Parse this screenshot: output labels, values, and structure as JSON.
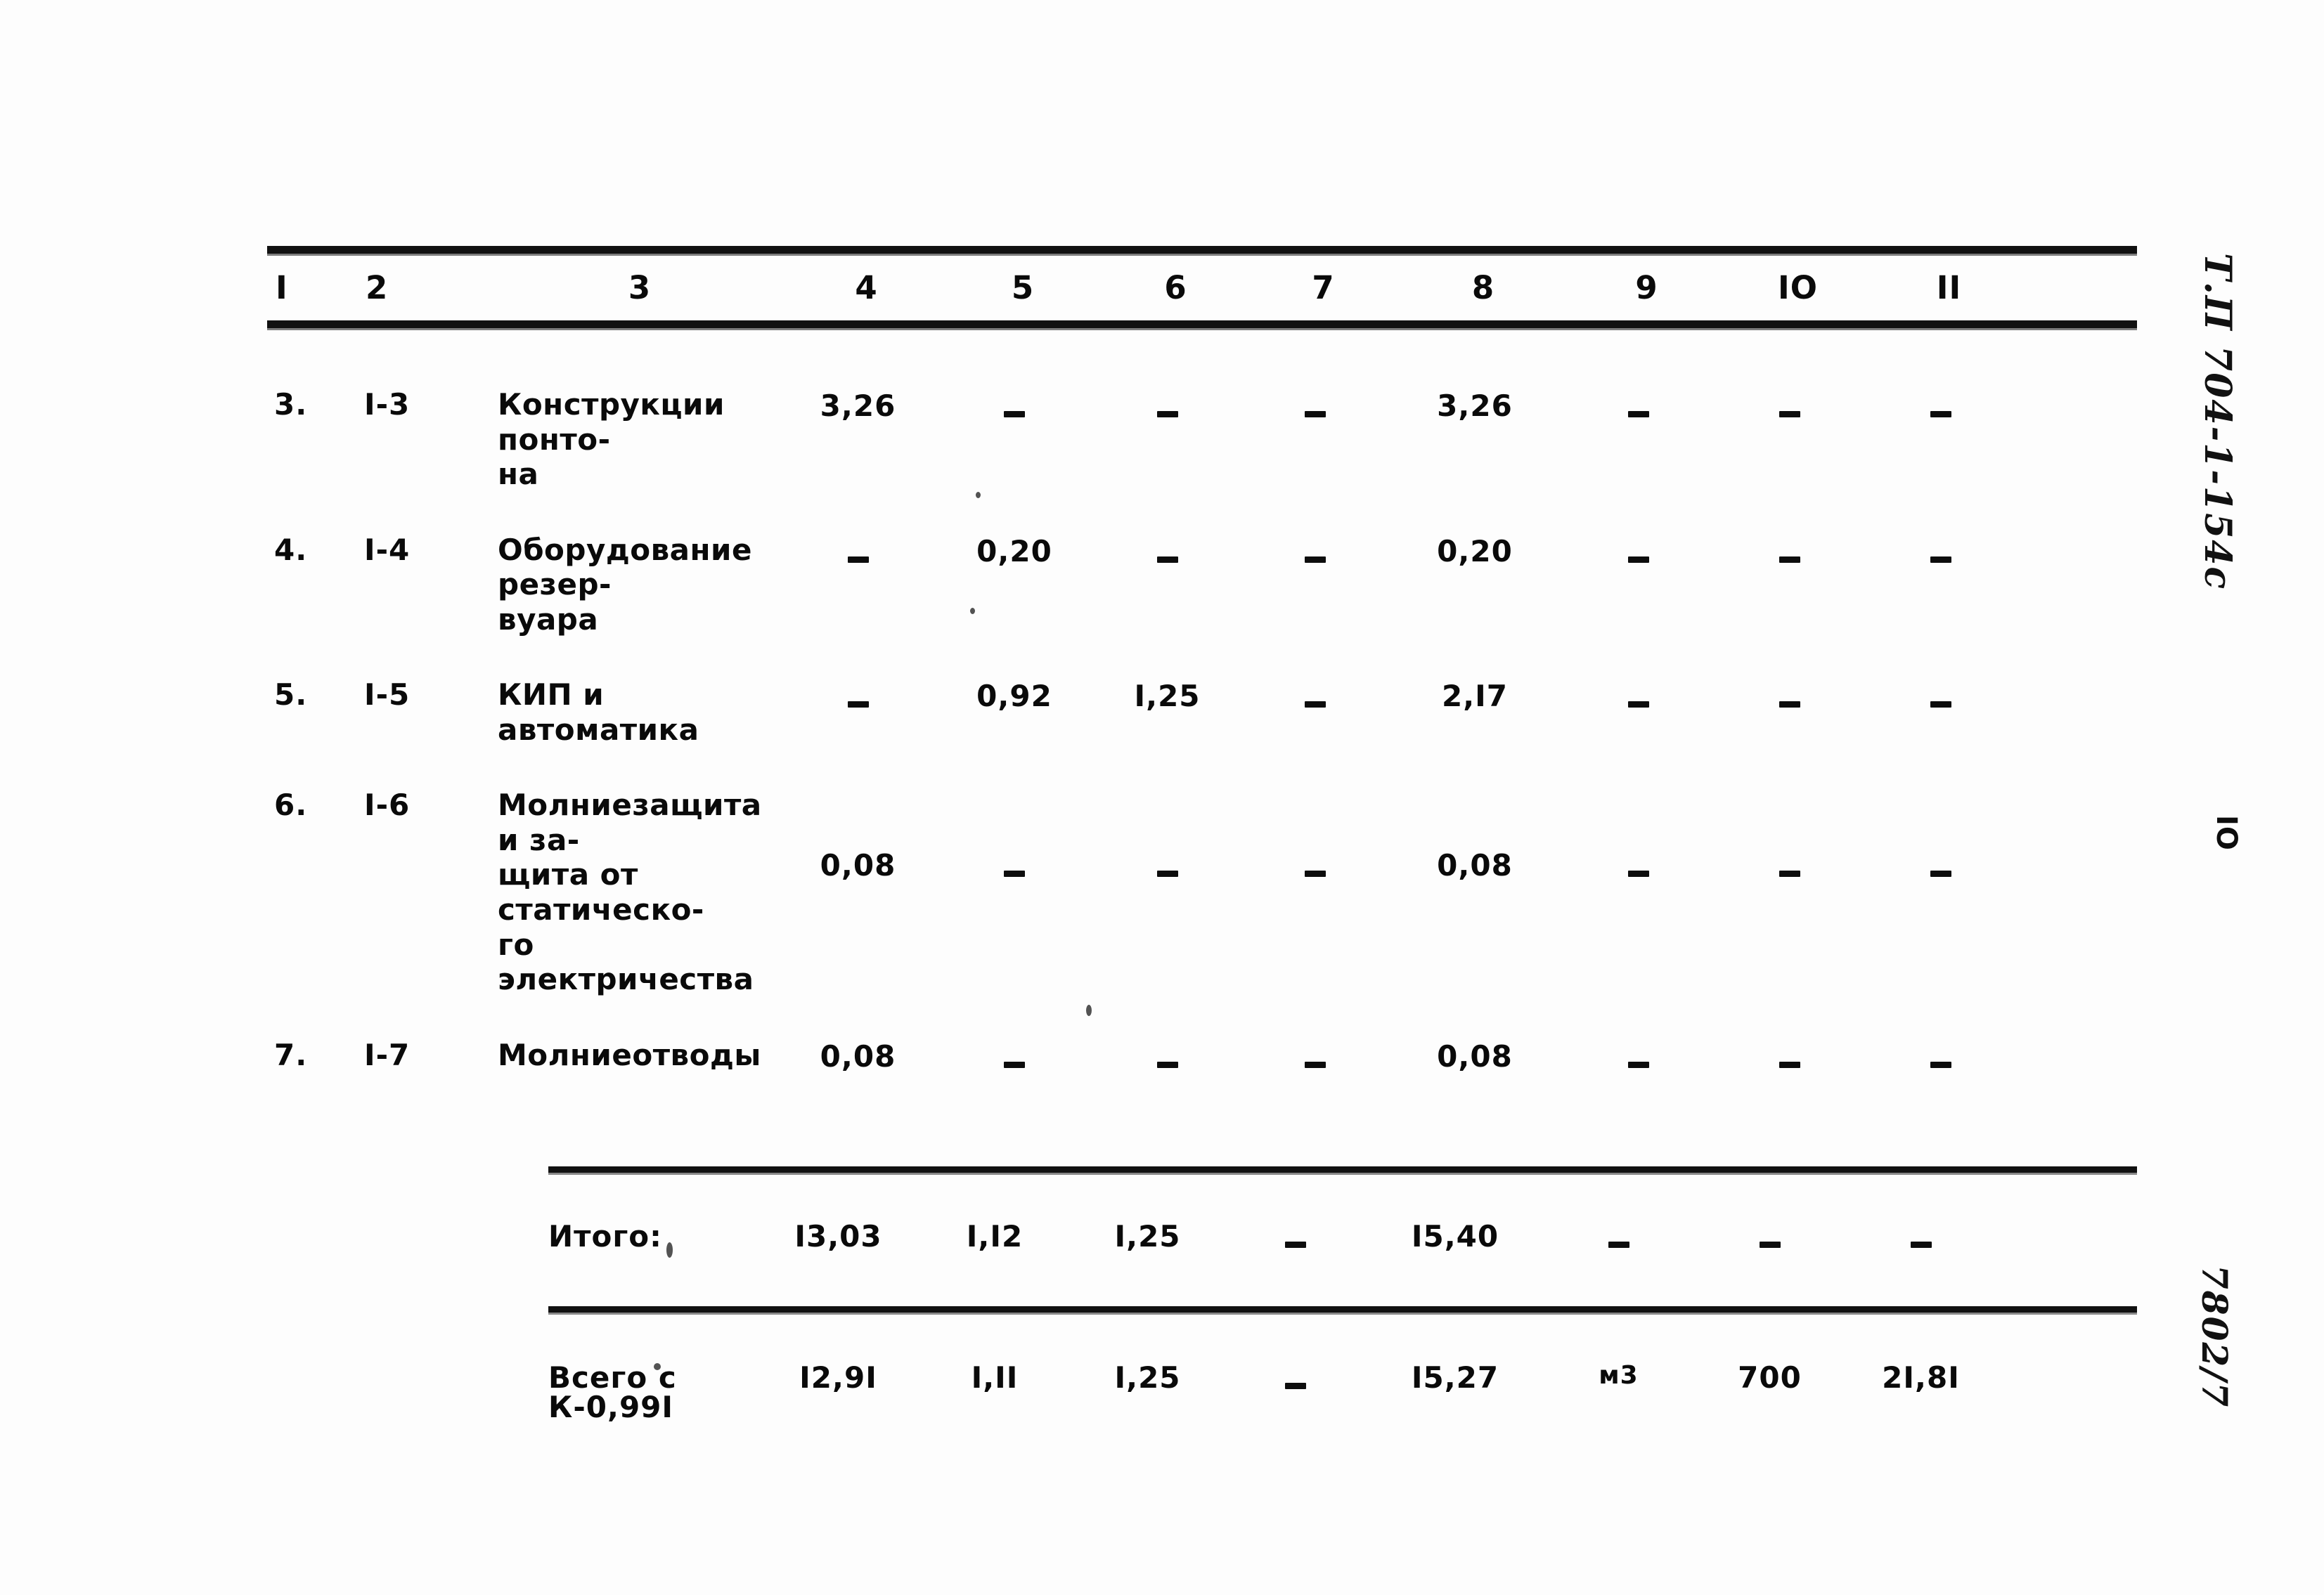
{
  "document": {
    "page_number": "IO",
    "project_code_note": "Т.П 704-1-154с",
    "sheet_note": "7802/7"
  },
  "table": {
    "column_headers": [
      "I",
      "2",
      "3",
      "4",
      "5",
      "6",
      "7",
      "8",
      "9",
      "IO",
      "II"
    ],
    "dash": "–",
    "rows": [
      {
        "num": "3.",
        "code": "I-3",
        "desc": "Конструкции понто-\nна",
        "c4": "3,26",
        "c5": "-",
        "c6": "-",
        "c7": "-",
        "c8": "3,26",
        "c9": "-",
        "c10": "-",
        "c11": "-"
      },
      {
        "num": "4.",
        "code": "I-4",
        "desc": "Оборудование резер-\nвуара",
        "c4": "-",
        "c5": "0,20",
        "c6": "-",
        "c7": "-",
        "c8": "0,20",
        "c9": "-",
        "c10": "-",
        "c11": "-"
      },
      {
        "num": "5.",
        "code": "I-5",
        "desc": "КИП и автоматика",
        "c4": "-",
        "c5": "0,92",
        "c6": "I,25",
        "c7": "-",
        "c8": "2,I7",
        "c9": "-",
        "c10": "-",
        "c11": "-"
      },
      {
        "num": "6.",
        "code": "I-6",
        "desc": "Молниезащита и за-\nщита от статическо-\nго электричества",
        "c4": "0,08",
        "c5": "-",
        "c6": "-",
        "c7": "-",
        "c8": "0,08",
        "c9": "-",
        "c10": "-",
        "c11": "-"
      },
      {
        "num": "7.",
        "code": "I-7",
        "desc": "Молниеотводы",
        "c4": "0,08",
        "c5": "-",
        "c6": "-",
        "c7": "-",
        "c8": "0,08",
        "c9": "-",
        "c10": "-",
        "c11": "-"
      }
    ],
    "subtotal": {
      "label": "Итого:",
      "c4": "I3,03",
      "c5": "I,I2",
      "c6": "I,25",
      "c7": "-",
      "c8": "I5,40",
      "c9": "-",
      "c10": "-",
      "c11": "-"
    },
    "grand_total": {
      "label": "Всего с К-0,99I",
      "c4": "I2,9I",
      "c5": "I,II",
      "c6": "I,25",
      "c7": "-",
      "c8": "I5,27",
      "c9": "м3",
      "c10": "700",
      "c11": "2I,8I"
    }
  }
}
